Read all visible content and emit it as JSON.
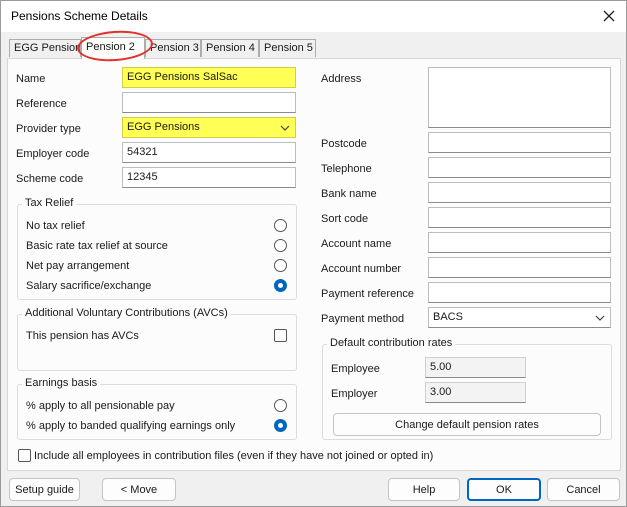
{
  "window": {
    "title": "Pensions Scheme Details"
  },
  "tabs": [
    {
      "label": "EGG Pensions"
    },
    {
      "label": "Pension 2"
    },
    {
      "label": "Pension 3"
    },
    {
      "label": "Pension 4"
    },
    {
      "label": "Pension 5"
    }
  ],
  "left": {
    "name": {
      "label": "Name",
      "value": "EGG Pensions SalSac"
    },
    "reference": {
      "label": "Reference",
      "value": ""
    },
    "provider_type": {
      "label": "Provider type",
      "value": "EGG Pensions"
    },
    "employer_code": {
      "label": "Employer code",
      "value": "54321"
    },
    "scheme_code": {
      "label": "Scheme code",
      "value": "12345"
    }
  },
  "tax_relief": {
    "title": "Tax Relief",
    "options": [
      {
        "label": "No tax relief",
        "selected": false
      },
      {
        "label": "Basic rate tax relief at source",
        "selected": false
      },
      {
        "label": "Net pay arrangement",
        "selected": false
      },
      {
        "label": "Salary sacrifice/exchange",
        "selected": true
      }
    ]
  },
  "avcs": {
    "title": "Additional Voluntary Contributions (AVCs)",
    "checkbox_label": "This pension has AVCs",
    "checked": false
  },
  "earnings_basis": {
    "title": "Earnings basis",
    "options": [
      {
        "label": "% apply to all pensionable pay",
        "selected": false
      },
      {
        "label": "% apply to banded qualifying earnings only",
        "selected": true
      }
    ]
  },
  "include_all": {
    "label": "Include all employees in contribution files (even if they have not joined or opted in)",
    "checked": false
  },
  "right": {
    "address": {
      "label": "Address",
      "value": ""
    },
    "postcode": {
      "label": "Postcode",
      "value": ""
    },
    "telephone": {
      "label": "Telephone",
      "value": ""
    },
    "bank_name": {
      "label": "Bank name",
      "value": ""
    },
    "sort_code": {
      "label": "Sort code",
      "value": ""
    },
    "account_name": {
      "label": "Account name",
      "value": ""
    },
    "account_number": {
      "label": "Account number",
      "value": ""
    },
    "payment_reference": {
      "label": "Payment reference",
      "value": ""
    },
    "payment_method": {
      "label": "Payment method",
      "value": "BACS"
    }
  },
  "default_rates": {
    "title": "Default contribution rates",
    "employee": {
      "label": "Employee",
      "value": "5.00"
    },
    "employer": {
      "label": "Employer",
      "value": "3.00"
    },
    "change_button": "Change default pension rates"
  },
  "footer": {
    "setup_guide": "Setup guide",
    "move": "< Move",
    "help": "Help",
    "ok": "OK",
    "cancel": "Cancel"
  },
  "colors": {
    "highlight_field": "#ffff55",
    "accent": "#0067c0",
    "annotation_ring": "#e0312b"
  }
}
